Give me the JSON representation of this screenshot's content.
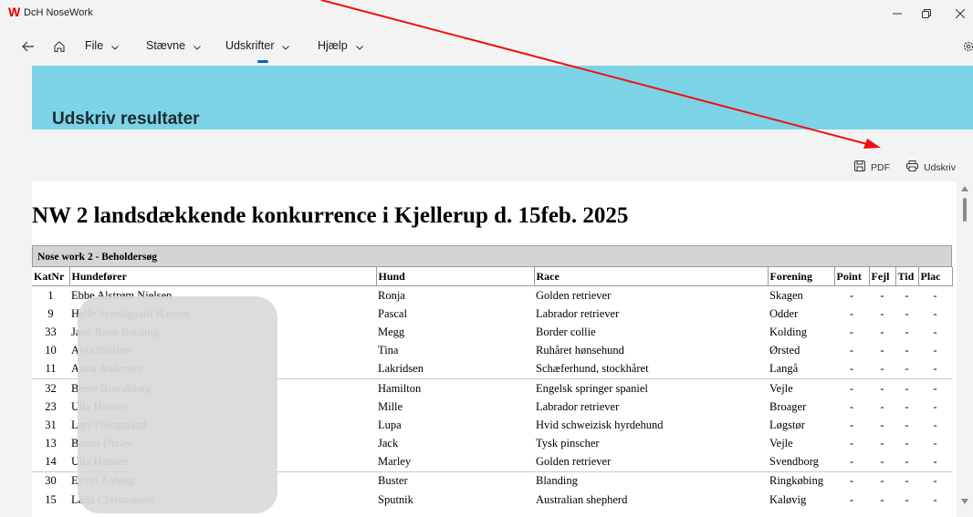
{
  "window": {
    "app_title": "DcH NoseWork",
    "logo_letter": "W",
    "logo_color": "#e00000",
    "controls": [
      "minimize-icon",
      "restore-icon",
      "close-icon"
    ]
  },
  "menu": {
    "back_icon": "arrow-left-icon",
    "home_icon": "home-icon",
    "items": [
      {
        "label": "File"
      },
      {
        "label": "Stævne"
      },
      {
        "label": "Udskrifter",
        "active": true
      },
      {
        "label": "Hjælp"
      }
    ],
    "settings_icon": "gear-icon",
    "accent": "#0067c0"
  },
  "banner": {
    "title": "Udskriv resultater",
    "color": "#7dd3e6"
  },
  "actions": {
    "pdf_label": "PDF",
    "print_label": "Udskriv"
  },
  "document": {
    "title": "NW 2 landsdækkende konkurrence i Kjellerup d. 15feb. 2025",
    "section": "Nose work 2 - Beholdersøg",
    "columns": [
      "KatNr",
      "Hundefører",
      "Hund",
      "Race",
      "Forening",
      "Point",
      "Fejl",
      "Tid",
      "Plac"
    ],
    "rows": [
      {
        "katnr": "1",
        "handler": "Ebbe Alstrøm Nielsen",
        "dog": "Ronja",
        "breed": "Golden retriever",
        "club": "Skagen",
        "point": "-",
        "fejl": "-",
        "tid": "-",
        "plac": "-"
      },
      {
        "katnr": "9",
        "handler": "Helle Svendgaard Hansen",
        "dog": "Pascal",
        "breed": "Labrador retriever",
        "club": "Odder",
        "point": "-",
        "fejl": "-",
        "tid": "-",
        "plac": "-"
      },
      {
        "katnr": "33",
        "handler": "Jane Ravn Bording",
        "dog": "Megg",
        "breed": "Border collie",
        "club": "Kolding",
        "point": "-",
        "fejl": "-",
        "tid": "-",
        "plac": "-"
      },
      {
        "katnr": "10",
        "handler": "Anja Nielsen",
        "dog": "Tina",
        "breed": "Ruhåret hønsehund",
        "club": "Ørsted",
        "point": "-",
        "fejl": "-",
        "tid": "-",
        "plac": "-"
      },
      {
        "katnr": "11",
        "handler": "Anita Andersen",
        "dog": "Lakridsen",
        "breed": "Schæferhund, stockhåret",
        "club": "Langå",
        "point": "-",
        "fejl": "-",
        "tid": "-",
        "plac": "-"
      },
      {
        "katnr": "32",
        "handler": "Bente Brøndsbøg",
        "dog": "Hamilton",
        "breed": "Engelsk springer spaniel",
        "club": "Vejle",
        "point": "-",
        "fejl": "-",
        "tid": "-",
        "plac": "-"
      },
      {
        "katnr": "23",
        "handler": "Ulla Hansen",
        "dog": "Mille",
        "breed": "Labrador retriever",
        "club": "Broager",
        "point": "-",
        "fejl": "-",
        "tid": "-",
        "plac": "-"
      },
      {
        "katnr": "31",
        "handler": "Lars Plougmand",
        "dog": "Lupa",
        "breed": "Hvid schweizisk hyrdehund",
        "club": "Løgstør",
        "point": "-",
        "fejl": "-",
        "tid": "-",
        "plac": "-"
      },
      {
        "katnr": "13",
        "handler": "Benna Ørslev",
        "dog": "Jack",
        "breed": "Tysk pinscher",
        "club": "Vejle",
        "point": "-",
        "fejl": "-",
        "tid": "-",
        "plac": "-"
      },
      {
        "katnr": "14",
        "handler": "Ulla Hansen",
        "dog": "Marley",
        "breed": "Golden retriever",
        "club": "Svendborg",
        "point": "-",
        "fejl": "-",
        "tid": "-",
        "plac": "-"
      },
      {
        "katnr": "30",
        "handler": "Eyvin Aaberg",
        "dog": "Buster",
        "breed": "Blanding",
        "club": "Ringkøbing",
        "point": "-",
        "fejl": "-",
        "tid": "-",
        "plac": "-"
      },
      {
        "katnr": "15",
        "handler": "Laila Christiansen",
        "dog": "Sputnik",
        "breed": "Australian shepherd",
        "club": "Kaløvig",
        "point": "-",
        "fejl": "-",
        "tid": "-",
        "plac": "-"
      }
    ]
  },
  "annotation": {
    "arrow_color": "#ee1111"
  }
}
